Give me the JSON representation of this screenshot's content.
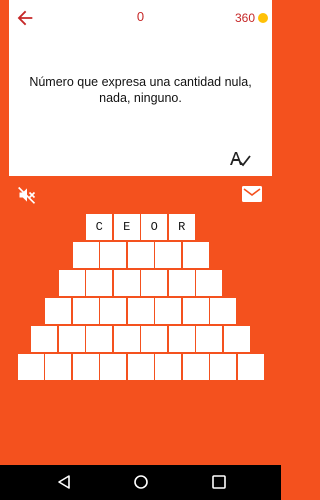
{
  "header": {
    "score": "0",
    "coins": "360",
    "back_icon": "back-arrow-icon",
    "coin_icon": "coin-icon"
  },
  "question": {
    "text": "Número que expresa una cantidad nula, nada, ninguno."
  },
  "controls": {
    "hint_icon": "spell-check-icon",
    "mute_icon": "volume-off-icon",
    "mail_icon": "mail-icon"
  },
  "pyramid": {
    "rows": [
      [
        "C",
        "E",
        "O",
        "R"
      ],
      [
        "",
        "",
        "",
        "",
        ""
      ],
      [
        "",
        "",
        "",
        "",
        "",
        ""
      ],
      [
        "",
        "",
        "",
        "",
        "",
        "",
        ""
      ],
      [
        "",
        "",
        "",
        "",
        "",
        "",
        "",
        ""
      ],
      [
        "",
        "",
        "",
        "",
        "",
        "",
        "",
        "",
        ""
      ]
    ]
  },
  "colors": {
    "background": "#f4511e",
    "accent": "#c62828",
    "coin": "#ffc107"
  },
  "navbar": {
    "back_icon": "nav-back-icon",
    "home_icon": "nav-home-icon",
    "recent_icon": "nav-recent-icon"
  }
}
